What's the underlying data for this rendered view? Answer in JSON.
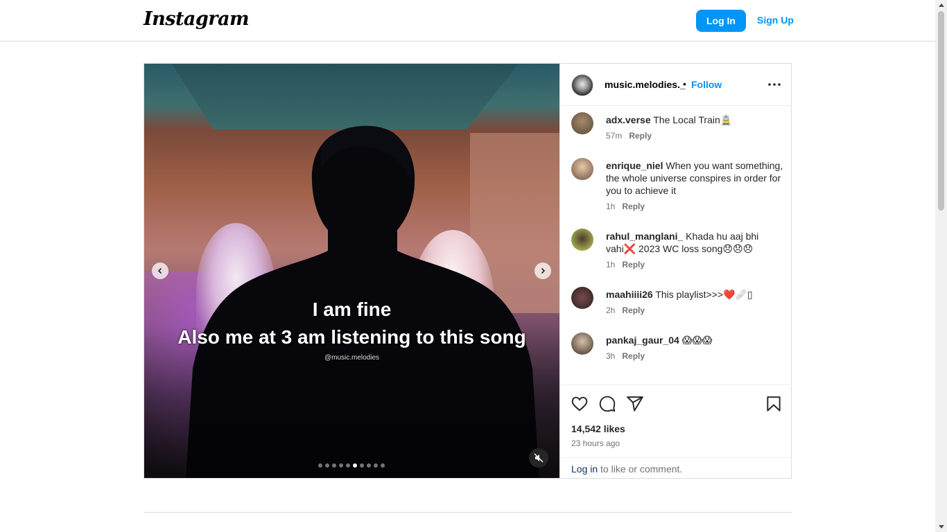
{
  "brand": {
    "logo_text": "Instagram",
    "accent_color": "#0095f6"
  },
  "header": {
    "login_label": "Log In",
    "signup_label": "Sign Up"
  },
  "media": {
    "caption_line1": "I am fine",
    "caption_line2": "Also me at 3 am listening to this song",
    "watermark": "@music.melodies",
    "slide_count": 10,
    "active_slide": 6,
    "muted": true
  },
  "post_header": {
    "username": "music.melodies._",
    "separator": "•",
    "follow_label": "Follow"
  },
  "comments": [
    {
      "user": "adx.verse",
      "text": "The Local Train🚊",
      "time": "57m",
      "reply": "Reply"
    },
    {
      "user": "enrique_niel",
      "text": "When you want something, the whole universe conspires in order for you to achieve it",
      "time": "1h",
      "reply": "Reply"
    },
    {
      "user": "rahul_manglani_",
      "text": "Khada hu aaj bhi vahi❌ 2023 WC loss song😞😞😞",
      "time": "1h",
      "reply": "Reply"
    },
    {
      "user": "maahiiii26",
      "text": "This playlist>>>❤️🩹▯",
      "time": "2h",
      "reply": "Reply"
    },
    {
      "user": "pankaj_gaur_04",
      "text": "😱😱😱",
      "time": "3h",
      "reply": "Reply"
    }
  ],
  "engagement": {
    "likes": "14,542 likes",
    "time_ago": "23 hours ago",
    "login_link": "Log in",
    "login_suffix": " to like or comment."
  },
  "icons": [
    "heart-icon",
    "comment-icon",
    "share-icon",
    "bookmark-icon",
    "more-options-icon",
    "mute-icon",
    "chevron-left-icon",
    "chevron-right-icon"
  ]
}
